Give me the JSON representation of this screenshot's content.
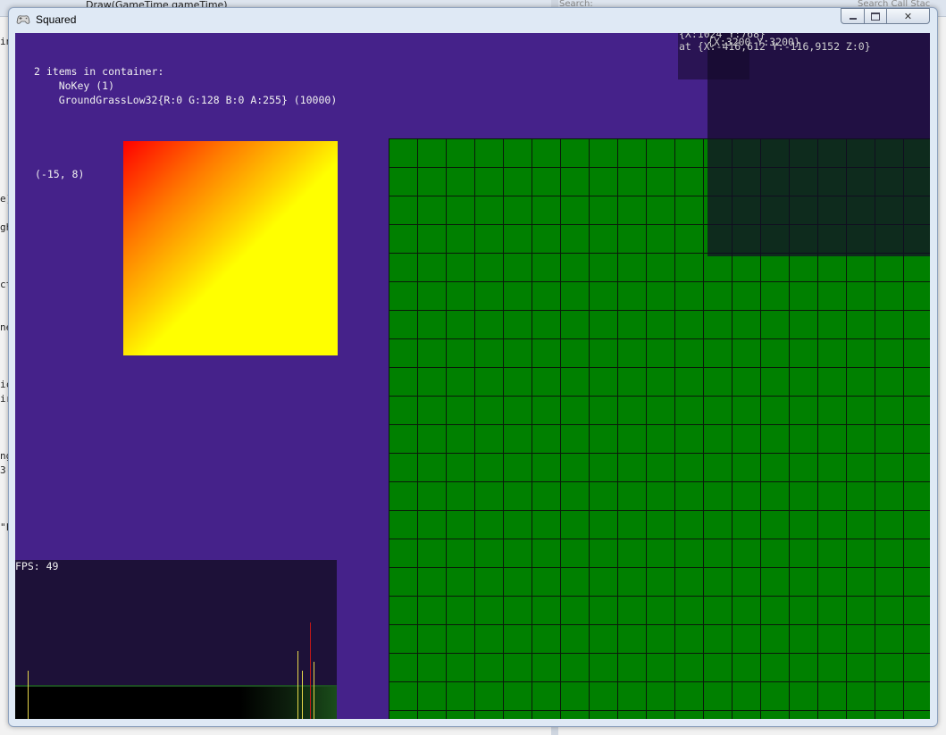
{
  "ide": {
    "tab_label": "Draw(GameTime gameTime)",
    "search_label": "Search:",
    "search_call_stack": "Search Call Stac",
    "left_snippets": [
      "in",
      "e)",
      "gh",
      "ct",
      "ne",
      "ic",
      "ir",
      "ng",
      "3(",
      "\"F"
    ]
  },
  "window": {
    "title": "Squared",
    "controls": {
      "minimize": "▭",
      "maximize": "□",
      "close": "✕"
    }
  },
  "client": {
    "container_info": [
      "2 items in container:",
      "    NoKey (1)",
      "    GroundGrassLow32{R:0 G:128 B:0 A:255} (10000)"
    ],
    "cursor_coords": "(-15, 8)",
    "debug_line1": "{X:1024 Y:768}",
    "debug_line1b": "{X:3200 Y:3200}",
    "debug_line2": "at {X:-416,612 Y:-116,9152 Z:0}",
    "fps_label": "FPS: 49"
  },
  "colors": {
    "background": "#45228a",
    "grid_fill": "#008000",
    "grid_line": "#0a1a0a",
    "fps_panel": "#1d1138"
  }
}
